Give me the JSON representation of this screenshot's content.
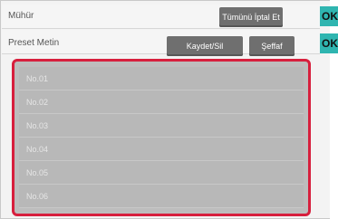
{
  "header": {
    "stamp_label": "Mühür",
    "cancel_all_button": "Tümünü İptal Et",
    "ok_label": "OK"
  },
  "preset": {
    "label": "Preset Metin",
    "save_delete_button": "Kaydet/Sil",
    "transparent_button": "Şeffaf",
    "ok_label": "OK"
  },
  "presets": [
    {
      "label": "No.01"
    },
    {
      "label": "No.02"
    },
    {
      "label": "No.03"
    },
    {
      "label": "No.04"
    },
    {
      "label": "No.05"
    },
    {
      "label": "No.06"
    }
  ]
}
